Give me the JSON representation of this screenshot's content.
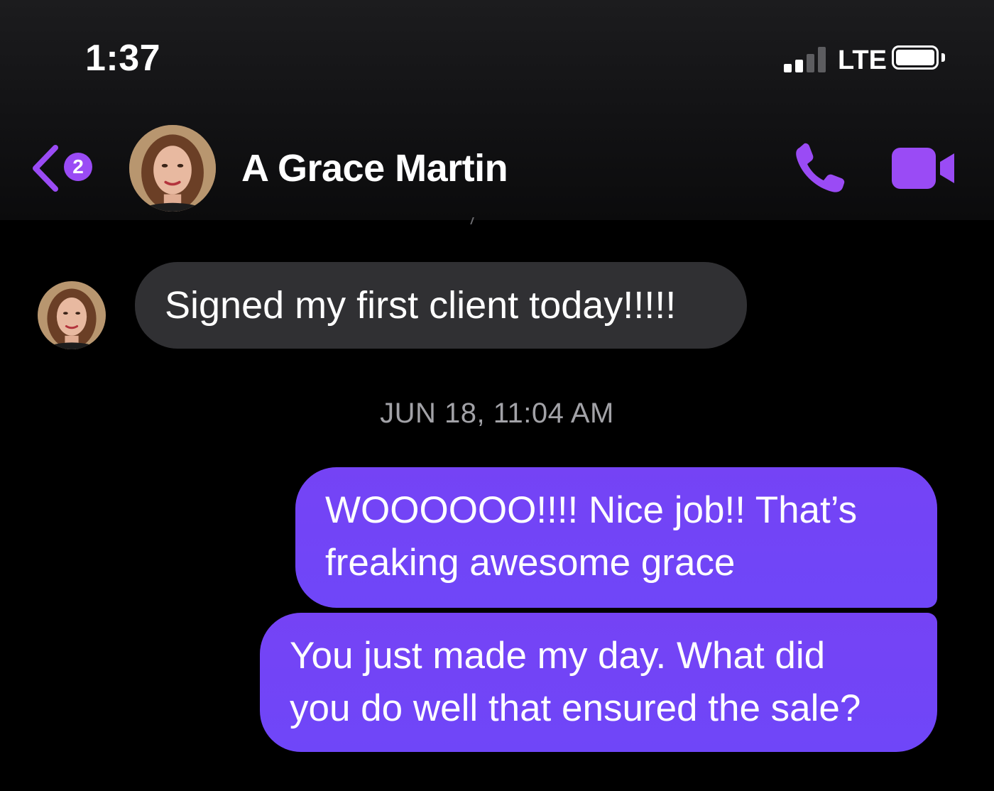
{
  "status_bar": {
    "time": "1:37",
    "network": "LTE"
  },
  "header": {
    "unread_count": "2",
    "contact_name": "A Grace Martin",
    "icons": [
      "back-chevron-icon",
      "phone-icon",
      "video-camera-icon"
    ]
  },
  "messages": [
    {
      "direction": "incoming",
      "text": "Signed my first client today!!!!!"
    },
    {
      "direction": "outgoing",
      "text": "WOOOOOO!!!! Nice job!! That’s\nfreaking awesome grace"
    },
    {
      "direction": "outgoing",
      "text": "You just made my day. What did\nyou do well that ensured the sale?"
    }
  ],
  "timestamp": "JUN 18, 11:04 AM",
  "colors": {
    "accent": "#9a4bf5",
    "outgoing_bubble": "#7045f6",
    "incoming_bubble": "#303033",
    "background": "#000000"
  }
}
